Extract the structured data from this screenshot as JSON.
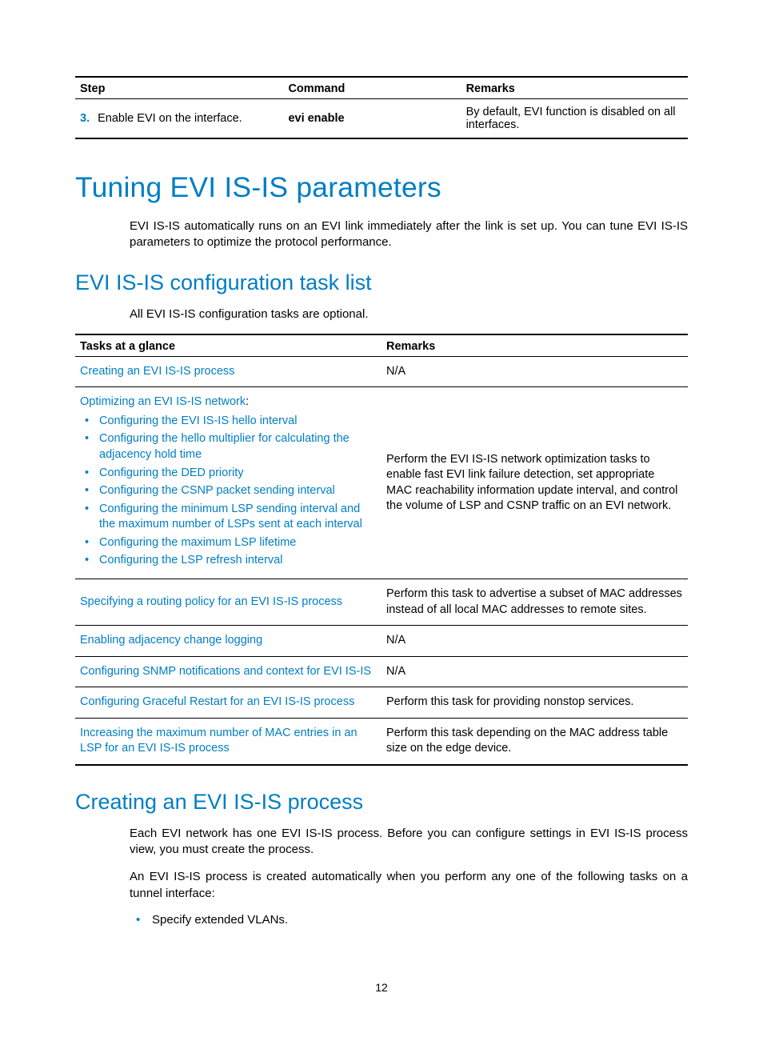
{
  "page_number": "12",
  "table1": {
    "headers": {
      "step": "Step",
      "command": "Command",
      "remarks": "Remarks"
    },
    "row": {
      "num": "3.",
      "step": "Enable EVI on the interface.",
      "command": "evi enable",
      "remarks": "By default, EVI function is disabled on all interfaces."
    }
  },
  "h1": "Tuning EVI IS-IS parameters",
  "p1": "EVI IS-IS automatically runs on an EVI link immediately after the link is set up. You can tune EVI IS-IS parameters to optimize the protocol performance.",
  "h2a": "EVI IS-IS configuration task list",
  "p2": "All EVI IS-IS configuration tasks are optional.",
  "table2": {
    "headers": {
      "tasks": "Tasks at a glance",
      "remarks": "Remarks"
    },
    "rows": [
      {
        "task": "Creating an EVI IS-IS process",
        "remarks": "N/A"
      }
    ],
    "row2": {
      "intro": "Optimizing an EVI IS-IS network",
      "colon": ":",
      "bullets": [
        "Configuring the EVI IS-IS hello interval",
        "Configuring the hello multiplier for calculating the adjacency hold time",
        "Configuring the DED priority",
        "Configuring the CSNP packet sending interval",
        "Configuring the minimum LSP sending interval and the maximum number of LSPs sent at each interval",
        "Configuring the maximum LSP lifetime",
        "Configuring the LSP refresh interval"
      ],
      "remarks": "Perform the EVI IS-IS network optimization tasks to enable fast EVI link failure detection, set appropriate MAC reachability information update interval, and control the volume of LSP and CSNP traffic on an EVI network."
    },
    "rows_after": [
      {
        "task": "Specifying a routing policy for an EVI IS-IS process",
        "remarks": "Perform this task to advertise a subset of MAC addresses instead of all local MAC addresses to remote sites."
      },
      {
        "task": "Enabling adjacency change logging",
        "remarks": "N/A"
      },
      {
        "task": "Configuring SNMP notifications and context for EVI IS-IS",
        "remarks": "N/A"
      },
      {
        "task": "Configuring Graceful Restart for an EVI IS-IS process",
        "remarks": "Perform this task for providing nonstop services."
      },
      {
        "task": "Increasing the maximum number of MAC entries in an LSP for an EVI IS-IS process",
        "remarks": "Perform this task depending on the MAC address table size on the edge device."
      }
    ]
  },
  "h2b": "Creating an EVI IS-IS process",
  "p3": "Each EVI network has one EVI IS-IS process. Before you can configure settings in EVI IS-IS process view, you must create the process.",
  "p4": "An EVI IS-IS process is created automatically when you perform any one of the following tasks on a tunnel interface:",
  "li1": "Specify extended VLANs."
}
